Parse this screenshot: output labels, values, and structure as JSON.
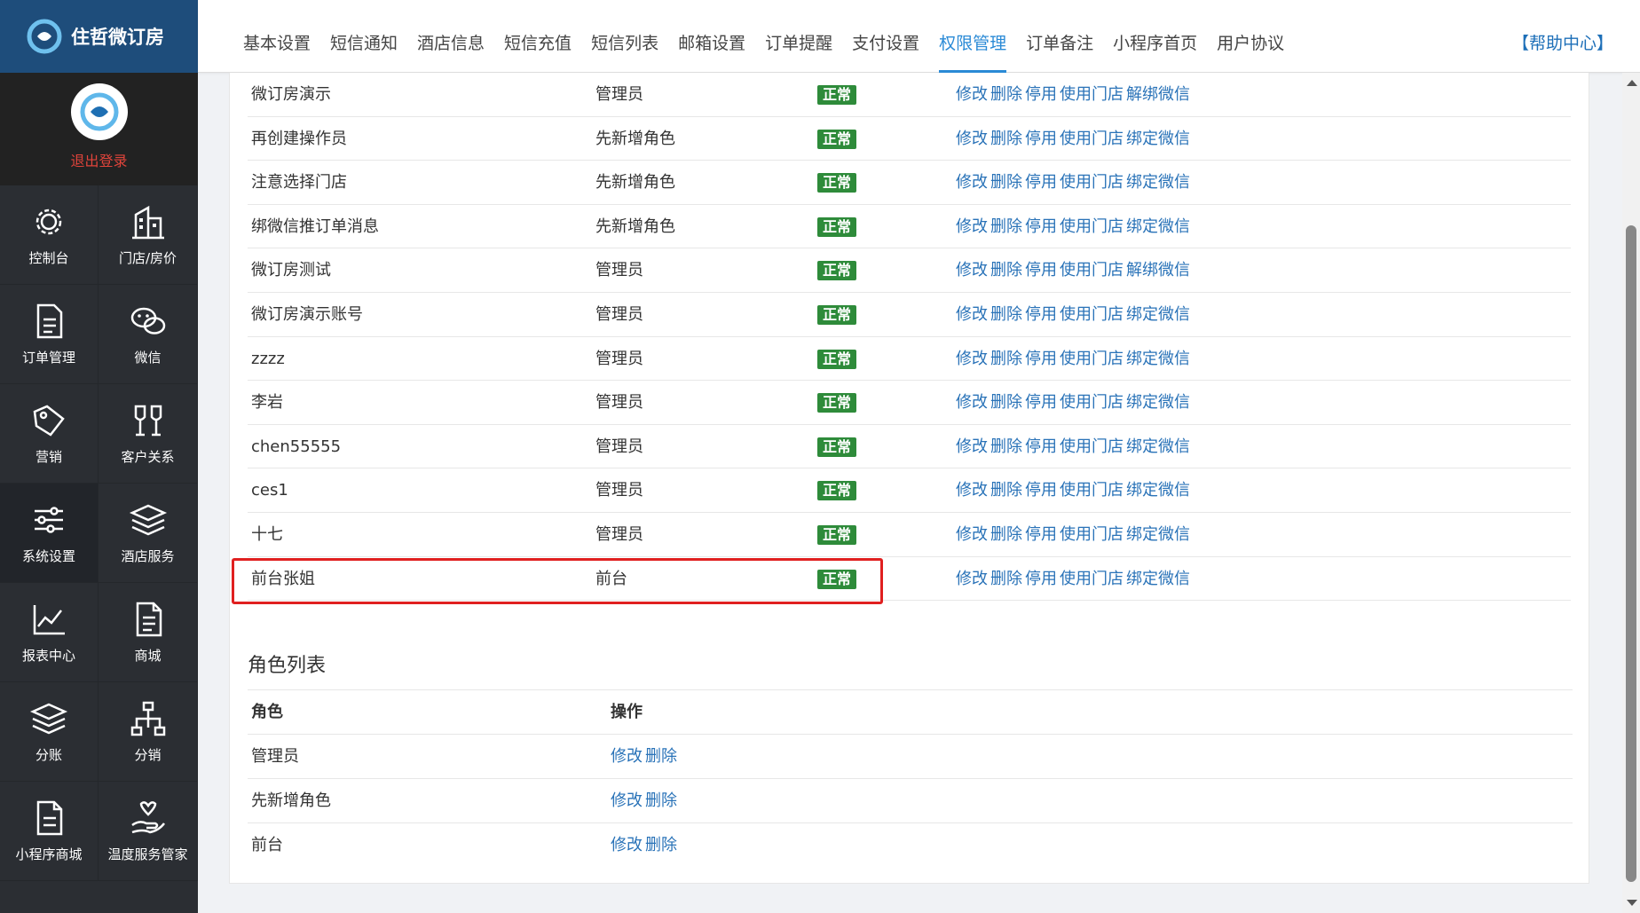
{
  "app": {
    "name": "住哲微订房",
    "logout": "退出登录",
    "help": "【帮助中心】"
  },
  "tabs": [
    {
      "label": "基本设置"
    },
    {
      "label": "短信通知"
    },
    {
      "label": "酒店信息"
    },
    {
      "label": "短信充值"
    },
    {
      "label": "短信列表"
    },
    {
      "label": "邮箱设置"
    },
    {
      "label": "订单提醒"
    },
    {
      "label": "支付设置"
    },
    {
      "label": "权限管理",
      "active": true
    },
    {
      "label": "订单备注"
    },
    {
      "label": "小程序首页"
    },
    {
      "label": "用户协议"
    }
  ],
  "nav": [
    {
      "label": "控制台",
      "icon": "gear-icon"
    },
    {
      "label": "门店/房价",
      "icon": "building-icon"
    },
    {
      "label": "订单管理",
      "icon": "document-icon"
    },
    {
      "label": "微信",
      "icon": "wechat-icon"
    },
    {
      "label": "营销",
      "icon": "tag-icon"
    },
    {
      "label": "客户关系",
      "icon": "glasses-icon"
    },
    {
      "label": "系统设置",
      "icon": "sliders-icon",
      "active": true
    },
    {
      "label": "酒店服务",
      "icon": "layers-icon"
    },
    {
      "label": "报表中心",
      "icon": "chart-icon"
    },
    {
      "label": "商城",
      "icon": "file-icon"
    },
    {
      "label": "分账",
      "icon": "stack-icon"
    },
    {
      "label": "分销",
      "icon": "network-icon"
    },
    {
      "label": "小程序商城",
      "icon": "miniapp-file-icon"
    },
    {
      "label": "温度服务管家",
      "icon": "hand-heart-icon"
    }
  ],
  "staff": [
    {
      "name": "微订房演示",
      "role": "管理员",
      "status": "正常",
      "ops": [
        "修改",
        "删除",
        "停用",
        "使用门店",
        "解绑微信"
      ]
    },
    {
      "name": "再创建操作员",
      "role": "先新增角色",
      "status": "正常",
      "ops": [
        "修改",
        "删除",
        "停用",
        "使用门店",
        "绑定微信"
      ]
    },
    {
      "name": "注意选择门店",
      "role": "先新增角色",
      "status": "正常",
      "ops": [
        "修改",
        "删除",
        "停用",
        "使用门店",
        "绑定微信"
      ]
    },
    {
      "name": "绑微信推订单消息",
      "role": "先新增角色",
      "status": "正常",
      "ops": [
        "修改",
        "删除",
        "停用",
        "使用门店",
        "绑定微信"
      ]
    },
    {
      "name": "微订房测试",
      "role": "管理员",
      "status": "正常",
      "ops": [
        "修改",
        "删除",
        "停用",
        "使用门店",
        "解绑微信"
      ]
    },
    {
      "name": "微订房演示账号",
      "role": "管理员",
      "status": "正常",
      "ops": [
        "修改",
        "删除",
        "停用",
        "使用门店",
        "绑定微信"
      ]
    },
    {
      "name": "zzzz",
      "role": "管理员",
      "status": "正常",
      "ops": [
        "修改",
        "删除",
        "停用",
        "使用门店",
        "绑定微信"
      ]
    },
    {
      "name": "李岩",
      "role": "管理员",
      "status": "正常",
      "ops": [
        "修改",
        "删除",
        "停用",
        "使用门店",
        "绑定微信"
      ]
    },
    {
      "name": "chen55555",
      "role": "管理员",
      "status": "正常",
      "ops": [
        "修改",
        "删除",
        "停用",
        "使用门店",
        "绑定微信"
      ]
    },
    {
      "name": "ces1",
      "role": "管理员",
      "status": "正常",
      "ops": [
        "修改",
        "删除",
        "停用",
        "使用门店",
        "绑定微信"
      ]
    },
    {
      "name": "十七",
      "role": "管理员",
      "status": "正常",
      "ops": [
        "修改",
        "删除",
        "停用",
        "使用门店",
        "绑定微信"
      ]
    },
    {
      "name": "前台张姐",
      "role": "前台",
      "status": "正常",
      "ops": [
        "修改",
        "删除",
        "停用",
        "使用门店",
        "绑定微信"
      ]
    }
  ],
  "roles": {
    "title": "角色列表",
    "header": {
      "role": "角色",
      "ops": "操作"
    },
    "rows": [
      {
        "role": "管理员",
        "ops": [
          "修改",
          "删除"
        ]
      },
      {
        "role": "先新增角色",
        "ops": [
          "修改",
          "删除"
        ]
      },
      {
        "role": "前台",
        "ops": [
          "修改",
          "删除"
        ]
      }
    ]
  },
  "colors": {
    "accent": "#2a8ad6",
    "status_ok": "#2e8b3a",
    "highlight": "#e02020",
    "sidebar": "#2b2e33",
    "logo_bg": "#1e4d7b",
    "link": "#2a73b8"
  }
}
